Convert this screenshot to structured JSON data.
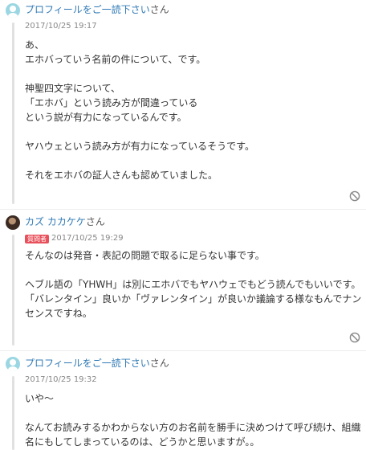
{
  "comments": [
    {
      "author": "プロフィールをご一読下さい",
      "suffix": "さん",
      "badge": "",
      "date": "2017/10/25 19:17",
      "text": "あ、\nエホバっていう名前の件について、です。\n\n神聖四文字について、\n「エホバ」という読み方が間違っている\nという説が有力になっているんです。\n\nヤハウェという読み方が有力になっているそうです。\n\nそれをエホバの証人さんも認めていました。"
    },
    {
      "author": "カズ カカケケ",
      "suffix": "さん",
      "badge": "質問者",
      "date": "2017/10/25 19:29",
      "text": "そんなのは発音・表記の問題で取るに足らない事です。\n\nヘブル語の「YHWH」は別にエホバでもヤハウェでもどう読んでもいいです。\n「バレンタイン」良いか「ヴァレンタイン」が良いか議論する様なもんでナンセンスですね。"
    },
    {
      "author": "プロフィールをご一読下さい",
      "suffix": "さん",
      "badge": "",
      "date": "2017/10/25 19:32",
      "text": "いや〜\n\nなんてお読みするかわからない方のお名前を勝手に決めつけて呼び続け、組織名にもしてしまっているのは、どうかと思いますが。。"
    }
  ],
  "icons": {
    "avatar": "user-avatar-icon",
    "report": "ban-icon"
  },
  "colors": {
    "link": "#2f79b5",
    "badge": "#e8505b",
    "line": "#e1e1e1"
  }
}
